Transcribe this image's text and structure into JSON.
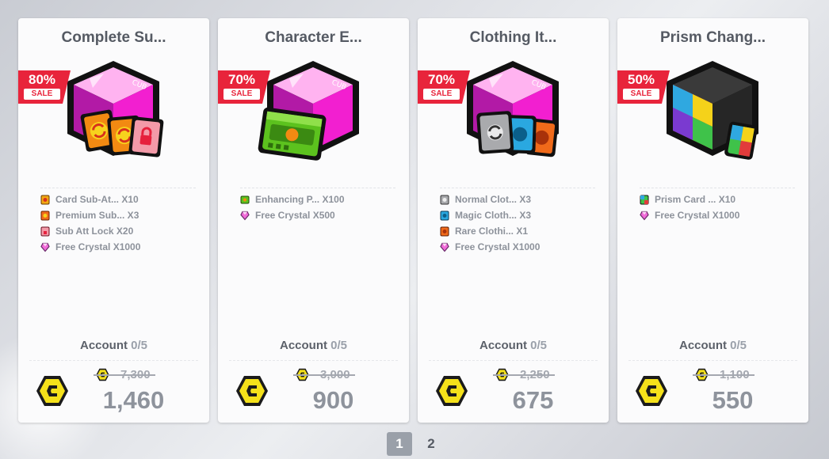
{
  "cards": [
    {
      "title": "Complete Su...",
      "sale_pct": "80%",
      "sale_word": "SALE",
      "items": [
        {
          "icon": "card-sub-attribute-icon",
          "text": "Card Sub-At... X10"
        },
        {
          "icon": "premium-sub-icon",
          "text": "Premium Sub... X3"
        },
        {
          "icon": "sub-att-lock-icon",
          "text": "Sub Att Lock X20"
        },
        {
          "icon": "free-crystal-icon",
          "text": "Free Crystal X1000"
        }
      ],
      "limit_label": "Account",
      "limit_count": "0/5",
      "old_price": "7,300",
      "new_price": "1,460"
    },
    {
      "title": "Character E...",
      "sale_pct": "70%",
      "sale_word": "SALE",
      "items": [
        {
          "icon": "enhancing-pack-icon",
          "text": "Enhancing P... X100"
        },
        {
          "icon": "free-crystal-icon",
          "text": "Free Crystal X500"
        }
      ],
      "limit_label": "Account",
      "limit_count": "0/5",
      "old_price": "3,000",
      "new_price": "900"
    },
    {
      "title": "Clothing It...",
      "sale_pct": "70%",
      "sale_word": "SALE",
      "items": [
        {
          "icon": "normal-clothing-icon",
          "text": "Normal Clot... X3"
        },
        {
          "icon": "magic-clothing-icon",
          "text": "Magic Cloth... X3"
        },
        {
          "icon": "rare-clothing-icon",
          "text": "Rare Clothi... X1"
        },
        {
          "icon": "free-crystal-icon",
          "text": "Free Crystal X1000"
        }
      ],
      "limit_label": "Account",
      "limit_count": "0/5",
      "old_price": "2,250",
      "new_price": "675"
    },
    {
      "title": "Prism Chang...",
      "sale_pct": "50%",
      "sale_word": "SALE",
      "items": [
        {
          "icon": "prism-card-icon",
          "text": "Prism Card ... X10"
        },
        {
          "icon": "free-crystal-icon",
          "text": "Free Crystal X1000"
        }
      ],
      "limit_label": "Account",
      "limit_count": "0/5",
      "old_price": "1,100",
      "new_price": "550"
    }
  ],
  "pagination": {
    "pages": [
      "1",
      "2"
    ],
    "active": "1"
  },
  "colors": {
    "sale_red": "#e8243b",
    "currency_yellow": "#f5e11a",
    "gem_pink": "#f21fd0"
  }
}
